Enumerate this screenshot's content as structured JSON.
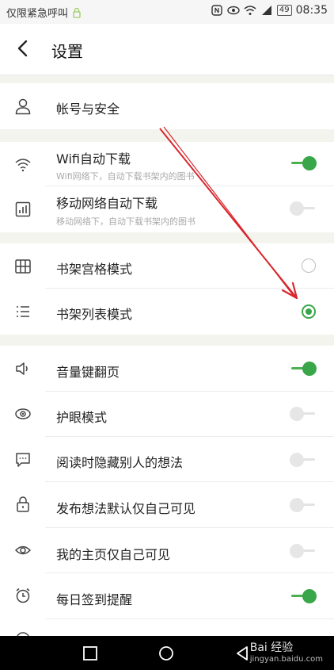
{
  "status_bar": {
    "carrier_text": "仅限紧急呼叫",
    "battery": "49",
    "time": "08:35"
  },
  "header": {
    "title": "设置"
  },
  "settings": {
    "account": {
      "label": "帐号与安全",
      "icon": "person-icon"
    },
    "wifi_download": {
      "label": "Wifi自动下载",
      "sub": "Wifi网络下，自动下载书架内的图书",
      "state": "on",
      "icon": "wifi-icon"
    },
    "mobile_download": {
      "label": "移动网络自动下载",
      "sub": "移动网络下，自动下载书架内的图书",
      "state": "off",
      "icon": "chart-icon"
    },
    "grid_mode": {
      "label": "书架宫格模式",
      "selected": false,
      "icon": "grid-icon"
    },
    "list_mode": {
      "label": "书架列表模式",
      "selected": true,
      "icon": "list-icon"
    },
    "volume_page": {
      "label": "音量键翻页",
      "state": "on",
      "icon": "speaker-icon"
    },
    "eye_mode": {
      "label": "护眼模式",
      "state": "off",
      "icon": "eye-icon"
    },
    "hide_thoughts": {
      "label": "阅读时隐藏别人的想法",
      "state": "off",
      "icon": "chat-icon"
    },
    "private_thoughts": {
      "label": "发布想法默认仅自己可见",
      "state": "off",
      "icon": "lock-icon"
    },
    "private_home": {
      "label": "我的主页仅自己可见",
      "state": "off",
      "icon": "eye-outline-icon"
    },
    "checkin_reminder": {
      "label": "每日签到提醒",
      "state": "on",
      "icon": "alarm-icon"
    }
  },
  "navbar": {
    "watermark": "Bai 经验",
    "watermark_url": "jingyan.baidu.com"
  },
  "colors": {
    "accent": "#3aa64a",
    "annotation_arrow": "#d9262c",
    "section_gap": "#f4f4ef"
  }
}
